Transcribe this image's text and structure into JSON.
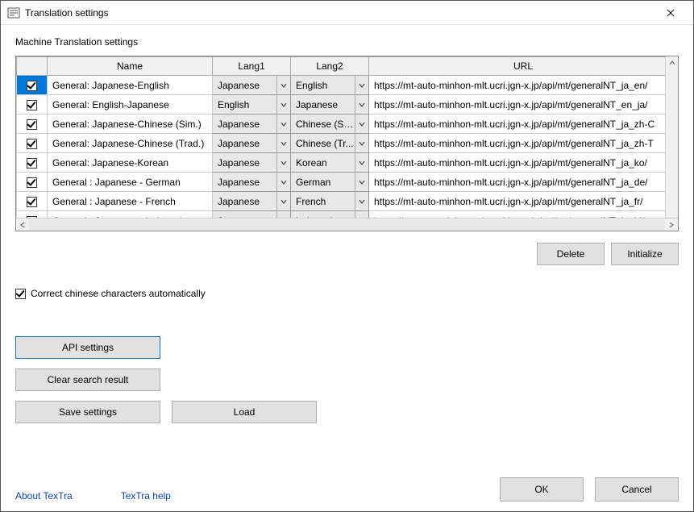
{
  "window": {
    "title": "Translation settings"
  },
  "section_label": "Machine Translation settings",
  "columns": {
    "name": "Name",
    "lang1": "Lang1",
    "lang2": "Lang2",
    "url": "URL"
  },
  "rows": [
    {
      "checked": true,
      "selected": true,
      "name": "General: Japanese-English",
      "lang1": "Japanese",
      "lang2": "English",
      "url": "https://mt-auto-minhon-mlt.ucri.jgn-x.jp/api/mt/generalNT_ja_en/"
    },
    {
      "checked": true,
      "selected": false,
      "name": "General: English-Japanese",
      "lang1": "English",
      "lang2": "Japanese",
      "url": "https://mt-auto-minhon-mlt.ucri.jgn-x.jp/api/mt/generalNT_en_ja/"
    },
    {
      "checked": true,
      "selected": false,
      "name": "General: Japanese-Chinese (Sim.)",
      "lang1": "Japanese",
      "lang2": "Chinese (Si...",
      "url": "https://mt-auto-minhon-mlt.ucri.jgn-x.jp/api/mt/generalNT_ja_zh-C"
    },
    {
      "checked": true,
      "selected": false,
      "name": "General: Japanese-Chinese (Trad.)",
      "lang1": "Japanese",
      "lang2": "Chinese (Tr...",
      "url": "https://mt-auto-minhon-mlt.ucri.jgn-x.jp/api/mt/generalNT_ja_zh-T"
    },
    {
      "checked": true,
      "selected": false,
      "name": "General: Japanese-Korean",
      "lang1": "Japanese",
      "lang2": "Korean",
      "url": "https://mt-auto-minhon-mlt.ucri.jgn-x.jp/api/mt/generalNT_ja_ko/"
    },
    {
      "checked": true,
      "selected": false,
      "name": "General : Japanese - German",
      "lang1": "Japanese",
      "lang2": "German",
      "url": "https://mt-auto-minhon-mlt.ucri.jgn-x.jp/api/mt/generalNT_ja_de/"
    },
    {
      "checked": true,
      "selected": false,
      "name": "General : Japanese - French",
      "lang1": "Japanese",
      "lang2": "French",
      "url": "https://mt-auto-minhon-mlt.ucri.jgn-x.jp/api/mt/generalNT_ja_fr/"
    },
    {
      "checked": true,
      "selected": false,
      "name": "General : Japanese - Indonesian",
      "lang1": "Japanese",
      "lang2": "Indonesian",
      "url": "https://mt-auto-minhon-mlt.ucri.jgn-x.jp/api/mt/generalNT_ja_id/"
    }
  ],
  "buttons": {
    "delete": "Delete",
    "initialize": "Initialize",
    "api_settings": "API settings",
    "clear_search": "Clear search result",
    "save_settings": "Save settings",
    "load": "Load",
    "ok": "OK",
    "cancel": "Cancel"
  },
  "auto_correct": {
    "checked": true,
    "label": "Correct chinese characters automatically"
  },
  "links": {
    "about": "About TexTra",
    "help": "TexTra help"
  }
}
